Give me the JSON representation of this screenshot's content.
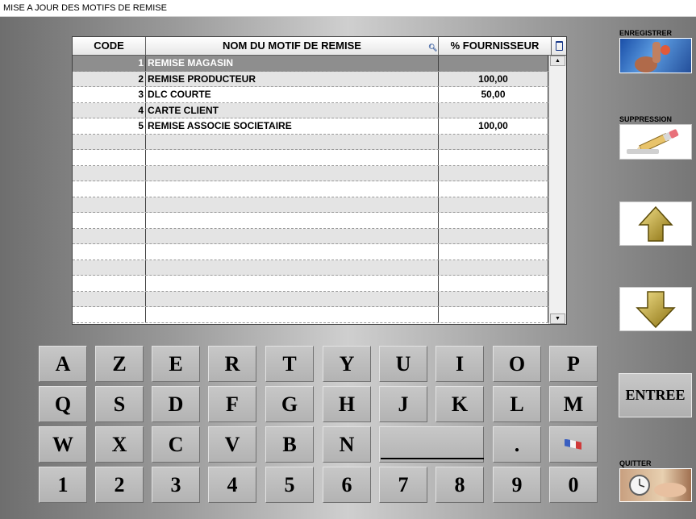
{
  "window": {
    "title": "MISE A JOUR DES MOTIFS DE REMISE"
  },
  "table": {
    "headers": {
      "code": "CODE",
      "name": "NOM DU MOTIF DE REMISE",
      "percent": "% FOURNISSEUR"
    },
    "rows": [
      {
        "code": "1",
        "name": "REMISE MAGASIN",
        "percent": ""
      },
      {
        "code": "2",
        "name": "REMISE PRODUCTEUR",
        "percent": "100,00"
      },
      {
        "code": "3",
        "name": "DLC COURTE",
        "percent": "50,00"
      },
      {
        "code": "4",
        "name": "CARTE CLIENT",
        "percent": ""
      },
      {
        "code": "5",
        "name": "REMISE ASSOCIE SOCIETAIRE",
        "percent": "100,00"
      }
    ],
    "selected_row": 1
  },
  "side": {
    "save_label": "ENREGISTRER",
    "delete_label": "SUPPRESSION",
    "enter_label": "ENTREE",
    "quit_label": "QUITTER"
  },
  "keyboard": {
    "row1": [
      "A",
      "Z",
      "E",
      "R",
      "T",
      "Y",
      "U",
      "I",
      "O",
      "P"
    ],
    "row2": [
      "Q",
      "S",
      "D",
      "F",
      "G",
      "H",
      "J",
      "K",
      "L",
      "M"
    ],
    "row3": [
      "W",
      "X",
      "C",
      "V",
      "B",
      "N",
      "",
      "",
      ".",
      ""
    ],
    "row4": [
      "1",
      "2",
      "3",
      "4",
      "5",
      "6",
      "7",
      "8",
      "9",
      "0"
    ]
  },
  "icons": {
    "search": "search-icon",
    "trash": "trash-icon",
    "up": "arrow-up-icon",
    "down": "arrow-down-icon",
    "flag": "french-flag-icon"
  }
}
